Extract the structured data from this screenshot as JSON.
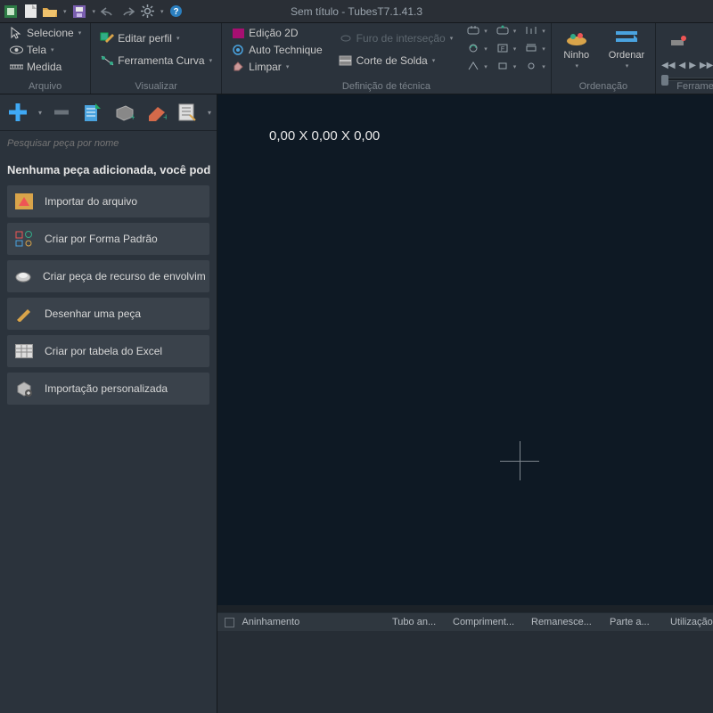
{
  "title": "Sem título - TubesT7.1.41.3",
  "ribbon": {
    "groups": {
      "arquivo": {
        "label": "Arquivo",
        "items": {
          "selecione": "Selecione",
          "tela": "Tela",
          "medida": "Medida"
        }
      },
      "visualizar": {
        "label": "Visualizar",
        "items": {
          "editar": "Editar perfil",
          "ferramenta": "Ferramenta Curva"
        }
      },
      "tecnica": {
        "label": "Definição de técnica",
        "items": {
          "edicao2d": "Edição 2D",
          "auto": "Auto Technique",
          "limpar": "Limpar",
          "furo": "Furo de interseção",
          "corte": "Corte de Solda"
        }
      },
      "ordenacao": {
        "label": "Ordenação",
        "ninho": "Ninho",
        "ordenar": "Ordenar"
      },
      "ferramenta": {
        "label": "Ferramenta"
      }
    }
  },
  "side": {
    "search_placeholder": "Pesquisar peça por nome",
    "empty_msg": "Nenhuma peça adicionada, você pod",
    "actions": {
      "importar": "Importar do arquivo",
      "forma": "Criar por Forma Padrão",
      "envolv": "Criar peça de recurso de envolvim",
      "desenhar": "Desenhar uma peça",
      "excel": "Criar por tabela do Excel",
      "custom": "Importação personalizada"
    }
  },
  "viewport": {
    "dimensions": "0,00 X 0,00 X 0,00"
  },
  "grid": {
    "aninhamento": "Aninhamento",
    "tubo": "Tubo an...",
    "compr": "Compriment...",
    "reman": "Remanesce...",
    "parte": "Parte a...",
    "util": "Utilização"
  }
}
